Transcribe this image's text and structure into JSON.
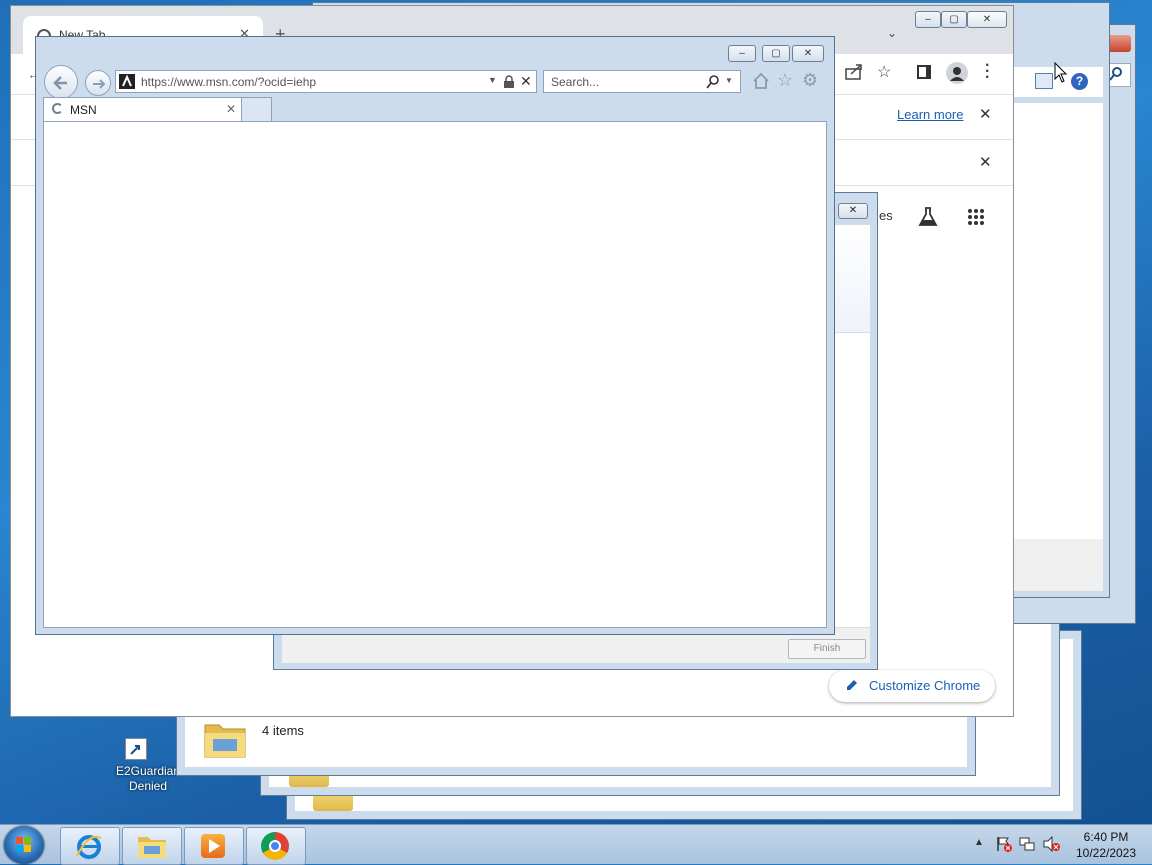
{
  "desktop": {
    "shortcut": {
      "label": "E2Guardian Denied",
      "icon": "shortcut-arrow-icon"
    }
  },
  "chrome": {
    "tab_title": "New Tab",
    "infobar": {
      "learn_more": "Learn more"
    },
    "customize_label": "Customize Chrome",
    "partial_text": "es"
  },
  "explorer": {
    "status_text": "4 items"
  },
  "wizard": {
    "finish_label": "Finish"
  },
  "ie": {
    "address": "https://www.msn.com/?ocid=iehp",
    "search_placeholder": "Search...",
    "tab_title": "MSN"
  },
  "taskbar": {
    "time": "6:40 PM",
    "date": "10/22/2023",
    "apps": [
      "internet-explorer",
      "file-explorer",
      "media-player",
      "google-chrome"
    ]
  },
  "colors": {
    "desktop": "#1f6fb8",
    "taskbar": "#a9c3de",
    "aero_frame": "#cddcec",
    "link": "#1a5fb4"
  }
}
